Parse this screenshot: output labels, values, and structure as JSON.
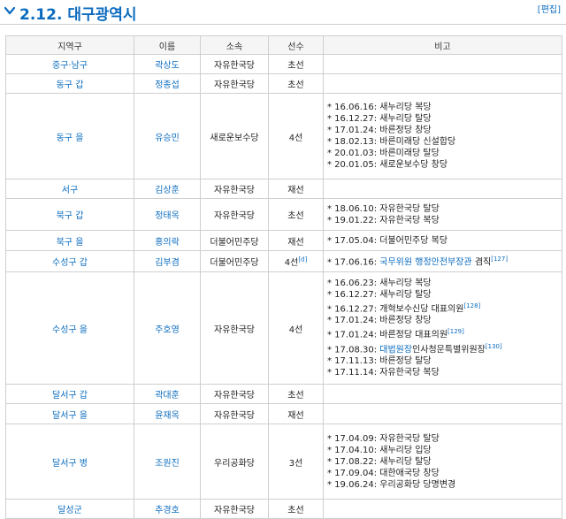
{
  "section": {
    "title": "2.12. 대구광역시",
    "edit": "[편집]"
  },
  "table": {
    "headers": [
      "지역구",
      "이름",
      "소속",
      "선수",
      "비고"
    ],
    "rows": [
      {
        "district": "중구·남구",
        "name": "곽상도",
        "party": "자유한국당",
        "terms": "초선",
        "terms_sup": "",
        "notes": []
      },
      {
        "district": "동구 갑",
        "name": "정종섭",
        "party": "자유한국당",
        "terms": "초선",
        "terms_sup": "",
        "notes": []
      },
      {
        "district": "동구 을",
        "name": "유승민",
        "party": "새로운보수당",
        "terms": "4선",
        "terms_sup": "",
        "notes": [
          {
            "text": "* 16.06.16: 새누리당 복당"
          },
          {
            "text": "* 16.12.27: 새누리당 탈당"
          },
          {
            "text": "* 17.01.24: 바른정당 창당"
          },
          {
            "text": "* 18.02.13: 바른미래당 신설합당"
          },
          {
            "text": "* 20.01.03: 바른미래당 탈당"
          },
          {
            "text": "* 20.01.05: 새로운보수당 창당"
          }
        ]
      },
      {
        "district": "서구",
        "name": "김상훈",
        "party": "자유한국당",
        "terms": "재선",
        "terms_sup": "",
        "notes": []
      },
      {
        "district": "북구 갑",
        "name": "정태옥",
        "party": "자유한국당",
        "terms": "초선",
        "terms_sup": "",
        "notes": [
          {
            "text": "* 18.06.10: 자유한국당 탈당"
          },
          {
            "text": "* 19.01.22: 자유한국당 복당"
          }
        ]
      },
      {
        "district": "북구 을",
        "name": "홍의락",
        "party": "더불어민주당",
        "terms": "재선",
        "terms_sup": "",
        "notes": [
          {
            "text": "* 17.05.04: 더불어민주당 복당"
          }
        ]
      },
      {
        "district": "수성구 갑",
        "name": "김부겸",
        "party": "더불어민주당",
        "terms": "4선",
        "terms_sup": "[d]",
        "notes": [
          {
            "pre": "* 17.06.16: ",
            "link": "국무위원 행정안전부장관",
            "post": " 겸직",
            "sup": "[127]"
          }
        ]
      },
      {
        "district": "수성구 을",
        "name": "주호영",
        "party": "자유한국당",
        "terms": "4선",
        "terms_sup": "",
        "notes": [
          {
            "text": "* 16.06.23: 새누리당 복당"
          },
          {
            "text": "* 16.12.27: 새누리당 탈당"
          },
          {
            "text": "* 16.12.27: 개혁보수신당 대표의원",
            "sup": "[128]"
          },
          {
            "text": "* 17.01.24: 바른정당 창당"
          },
          {
            "text": "* 17.01.24: 바른정당 대표의원",
            "sup": "[129]"
          },
          {
            "pre": "* 17.08.30: ",
            "link": "대법원장",
            "post": "인사청문특별위원장",
            "sup": "[130]"
          },
          {
            "text": "* 17.11.13: 바른정당 탈당"
          },
          {
            "text": "* 17.11.14: 자유한국당 복당"
          }
        ]
      },
      {
        "district": "달서구 갑",
        "name": "곽대훈",
        "party": "자유한국당",
        "terms": "초선",
        "terms_sup": "",
        "notes": []
      },
      {
        "district": "달서구 을",
        "name": "윤재옥",
        "party": "자유한국당",
        "terms": "재선",
        "terms_sup": "",
        "notes": []
      },
      {
        "district": "달서구 병",
        "name": "조원진",
        "party": "우리공화당",
        "terms": "3선",
        "terms_sup": "",
        "notes": [
          {
            "text": "* 17.04.09: 자유한국당 탈당"
          },
          {
            "text": "* 17.04.10: 새누리당 입당"
          },
          {
            "text": "* 17.08.22: 새누리당 탈당"
          },
          {
            "text": "* 17.09.04: 대한애국당 창당"
          },
          {
            "text": "* 19.06.24: 우리공화당 당명변경"
          }
        ]
      },
      {
        "district": "달성군",
        "name": "추경호",
        "party": "자유한국당",
        "terms": "초선",
        "terms_sup": "",
        "notes": []
      }
    ]
  },
  "icons": {
    "collapse": "chevron-down-icon"
  },
  "colors": {
    "link": "#0b6cbf",
    "border": "#cfcfcf",
    "header_bg": "#f5f5f5"
  }
}
